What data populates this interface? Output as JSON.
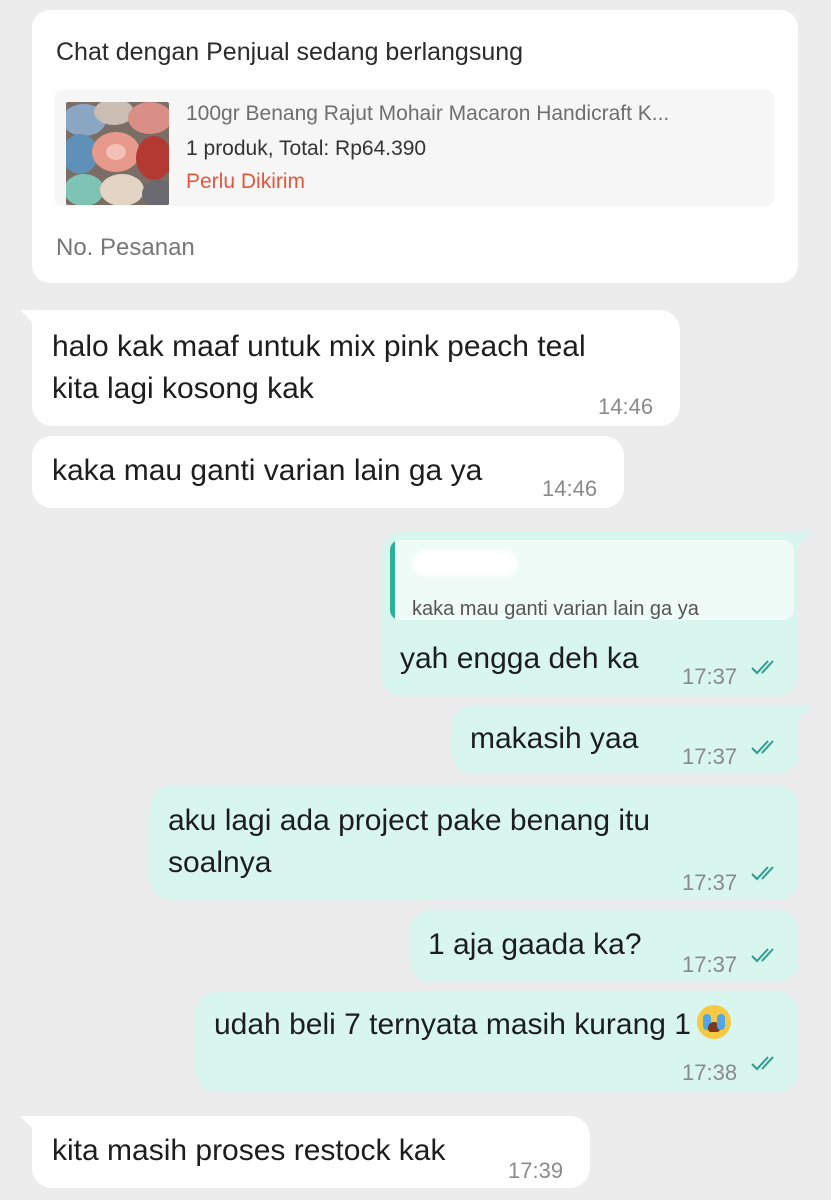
{
  "order_card": {
    "title": "Chat dengan Penjual sedang berlangsung",
    "product_name": "100gr Benang Rajut Mohair Macaron Handicraft K...",
    "product_summary": "1 produk, Total: Rp64.390",
    "status": "Perlu Dikirim",
    "order_number_label": "No. Pesanan"
  },
  "messages": [
    {
      "direction": "in",
      "text": "halo kak maaf untuk mix pink peach teal\nkita lagi kosong kak",
      "time": "14:46"
    },
    {
      "direction": "in",
      "text": "kaka mau ganti varian lain ga ya",
      "time": "14:46"
    },
    {
      "direction": "out",
      "quote": "kaka mau ganti varian lain ga ya",
      "text": "yah engga deh ka",
      "time": "17:37",
      "read": true
    },
    {
      "direction": "out",
      "text": "makasih yaa",
      "time": "17:37",
      "read": true
    },
    {
      "direction": "out",
      "text": "aku lagi ada project pake benang itu\nsoalnya",
      "time": "17:37",
      "read": true
    },
    {
      "direction": "out",
      "text": "1 aja gaada ka?",
      "time": "17:37",
      "read": true
    },
    {
      "direction": "out",
      "text": "udah beli 7 ternyata masih kurang 1",
      "emoji": "loudly-crying-face",
      "time": "17:38",
      "read": true
    },
    {
      "direction": "in",
      "text": "kita masih proses restock kak",
      "time": "17:39"
    }
  ],
  "colors": {
    "background": "#ececec",
    "incoming_bubble": "#ffffff",
    "outgoing_bubble": "#d8f6ee",
    "status_orange": "#e8553a",
    "read_tick": "#2f9c8f"
  }
}
